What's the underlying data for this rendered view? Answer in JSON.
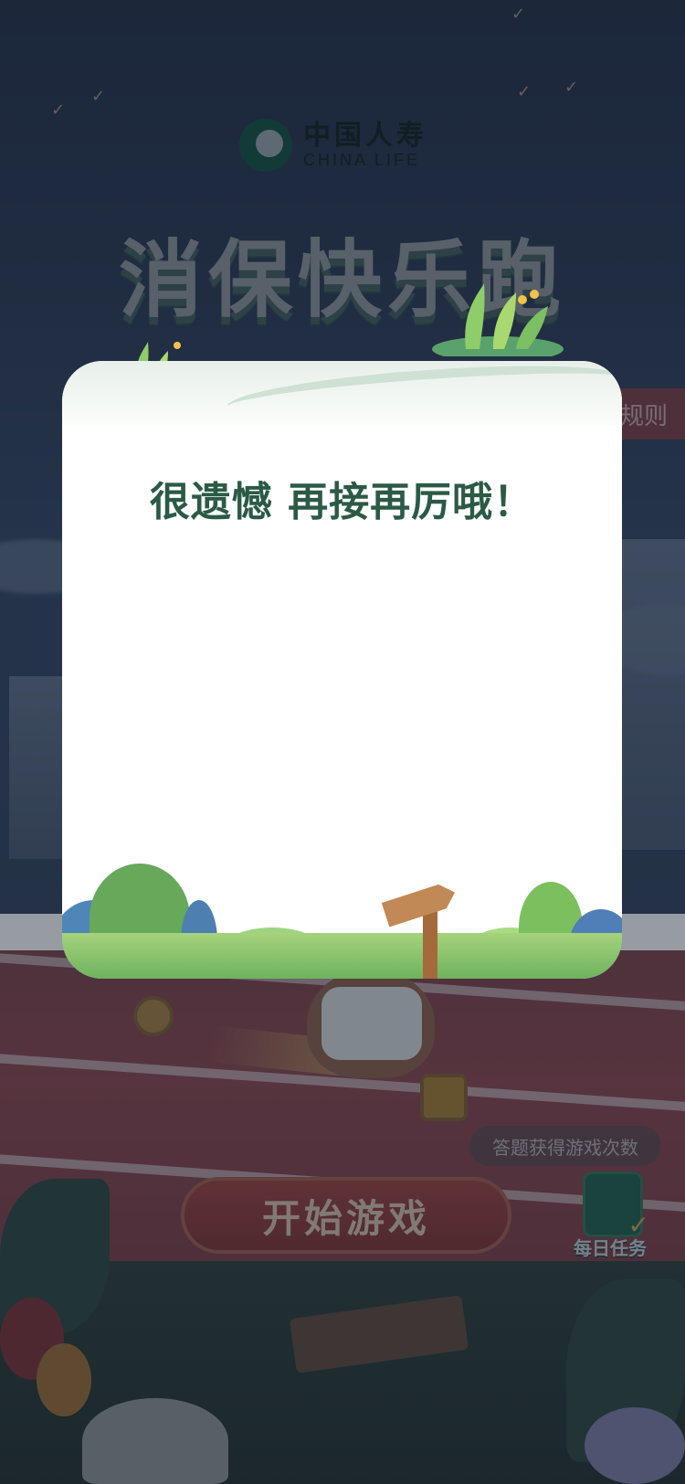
{
  "header": {
    "logo_cn": "中国人寿",
    "logo_en": "CHINA LIFE",
    "game_title": "消保快乐跑"
  },
  "side": {
    "rules_label": "规则"
  },
  "modal": {
    "message": "很遗憾 再接再厉哦！"
  },
  "main": {
    "quiz_hint": "答题获得游戏次数",
    "start_button": "开始游戏",
    "daily_task_label": "每日任务"
  },
  "colors": {
    "accent_green": "#2b5a45",
    "start_button_red": "#8d3632"
  }
}
